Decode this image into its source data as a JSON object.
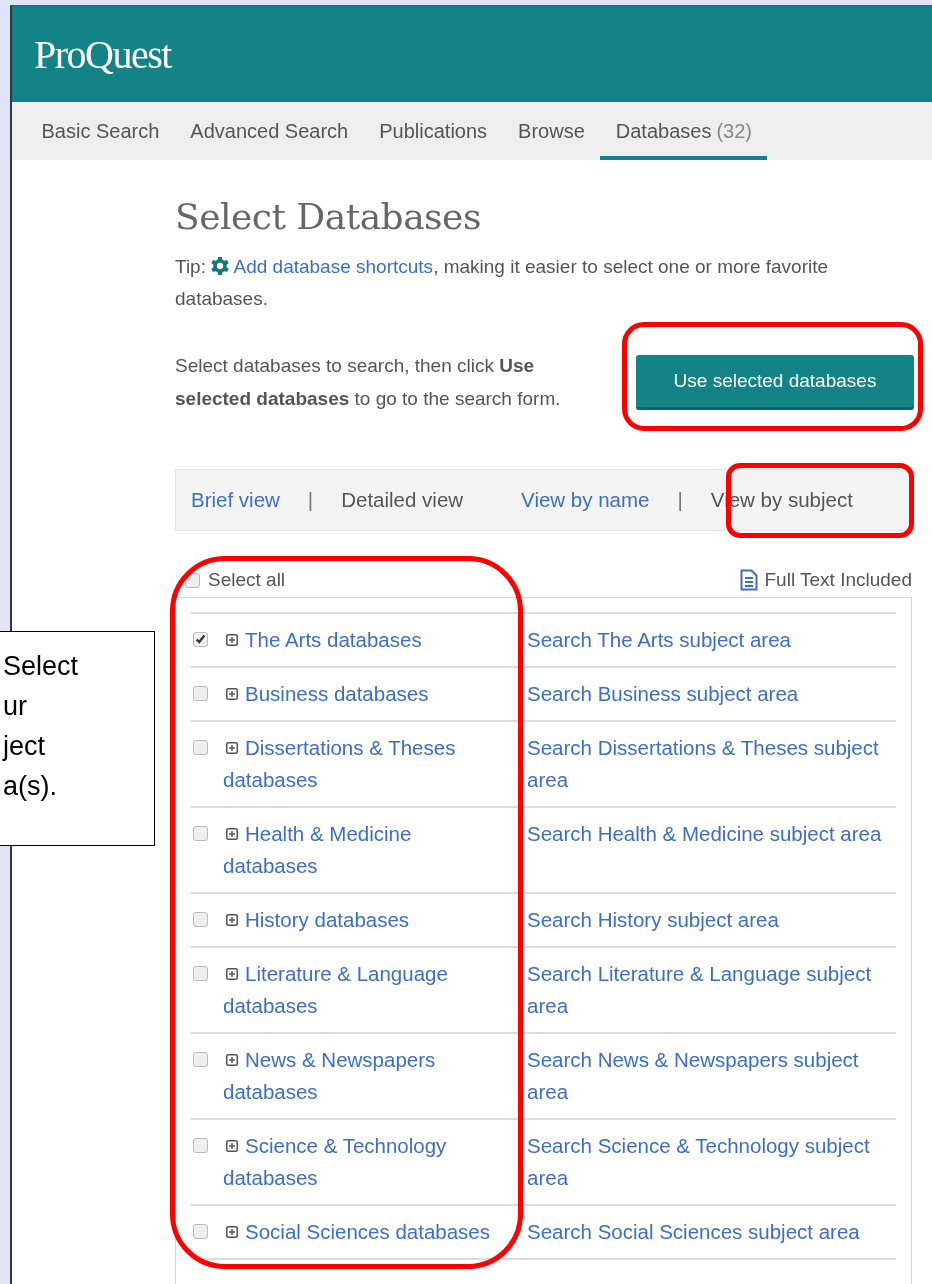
{
  "header": {
    "logo": "ProQuest"
  },
  "nav": [
    {
      "label": "Basic Search",
      "selected": false
    },
    {
      "label": "Advanced Search",
      "selected": false
    },
    {
      "label": "Publications",
      "selected": false
    },
    {
      "label": "Browse",
      "selected": false
    },
    {
      "label": "Databases",
      "count": "(32)",
      "selected": true
    }
  ],
  "title": "Select Databases",
  "tip": {
    "prefix": "Tip:",
    "link": "Add database shortcuts",
    "rest": ", making it easier to select one or more favorite databases."
  },
  "instruction": "Select databases to search, then click **Use selected databases** to go to the search form.",
  "use_button": "Use selected databases",
  "view_options": [
    {
      "kind": "option",
      "label": "Brief view",
      "selected": false
    },
    {
      "kind": "separator",
      "label": "|"
    },
    {
      "kind": "option",
      "label": "Detailed view",
      "selected": true
    },
    {
      "kind": "option",
      "label": "View by name",
      "selected": false
    },
    {
      "kind": "separator",
      "label": "|"
    },
    {
      "kind": "option",
      "label": "View by subject",
      "selected": true
    }
  ],
  "select_all": {
    "label": "Select all",
    "checked": false
  },
  "legend": "Full Text Included",
  "subjects": [
    {
      "name": "The Arts databases",
      "search": "Search The Arts subject area",
      "checked": true
    },
    {
      "name": "Business databases",
      "search": "Search Business subject area",
      "checked": false
    },
    {
      "name": "Dissertations & Theses databases",
      "search": "Search Dissertations & Theses subject area",
      "checked": false
    },
    {
      "name": "Health & Medicine databases",
      "search": "Search Health & Medicine subject area",
      "checked": false
    },
    {
      "name": "History databases",
      "search": "Search History subject area",
      "checked": false
    },
    {
      "name": "Literature & Language databases",
      "search": "Search Literature & Language subject area",
      "checked": false
    },
    {
      "name": "News & Newspapers databases",
      "search": "Search News & Newspapers subject area",
      "checked": false
    },
    {
      "name": "Science & Technology databases",
      "search": "Search Science & Technology subject area",
      "checked": false
    },
    {
      "name": "Social Sciences databases",
      "search": "Search Social Sciences subject area",
      "checked": false
    }
  ],
  "callout": {
    "lines": [
      "Select",
      "ur",
      "ject",
      "a(s)."
    ]
  }
}
